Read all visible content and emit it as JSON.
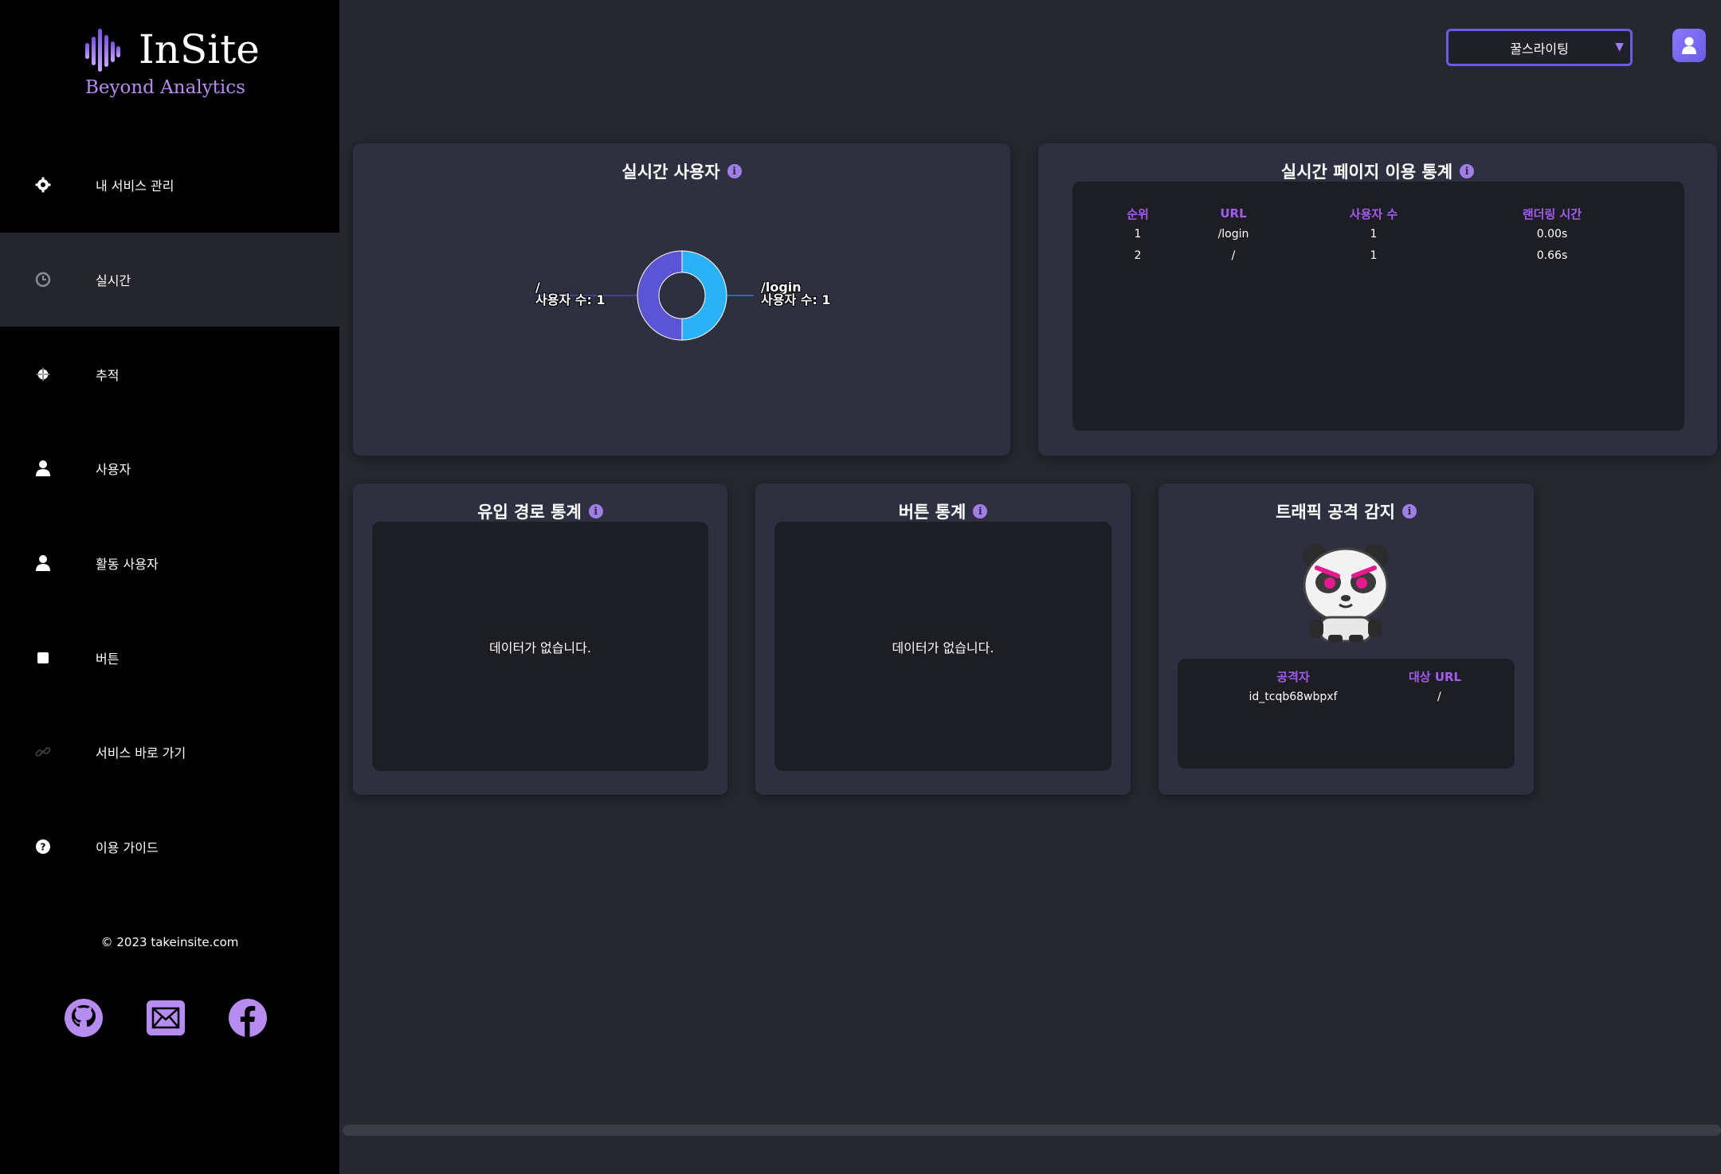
{
  "brand": {
    "title": "InSite",
    "subtitle": "Beyond Analytics",
    "accent": "#a06cf0"
  },
  "sidebar": {
    "items": [
      {
        "label": "내 서비스 관리",
        "icon": "gear-icon"
      },
      {
        "label": "실시간",
        "icon": "clock-icon",
        "active": true
      },
      {
        "label": "추적",
        "icon": "crosshair-icon"
      },
      {
        "label": "사용자",
        "icon": "user-icon"
      },
      {
        "label": "활동 사용자",
        "icon": "user-icon"
      },
      {
        "label": "버튼",
        "icon": "square-icon"
      },
      {
        "label": "서비스 바로 가기",
        "icon": "link-icon"
      },
      {
        "label": "이용 가이드",
        "icon": "help-circle-icon"
      }
    ],
    "copyright": "© 2023 takeinsite.com",
    "socials": [
      "github-icon",
      "mail-icon",
      "facebook-icon"
    ]
  },
  "header": {
    "service_select": "꿀스라이팅",
    "avatar_icon": "user-avatar-icon"
  },
  "realtime_users": {
    "title": "실시간 사용자",
    "chart_data": {
      "type": "pie",
      "donut": true,
      "slices": [
        {
          "name": "/",
          "value": 1,
          "color": "#5b55d6",
          "label_line1": "/",
          "label_line2": "사용자 수: 1"
        },
        {
          "name": "/login",
          "value": 1,
          "color": "#2bb1f7",
          "label_line1": "/login",
          "label_line2": "사용자 수: 1"
        }
      ]
    }
  },
  "page_stats": {
    "title": "실시간 페이지 이용 통계",
    "columns": [
      "순위",
      "URL",
      "사용자 수",
      "랜더링 시간"
    ],
    "rows": [
      [
        "1",
        "/login",
        "1",
        "0.00s"
      ],
      [
        "2",
        "/",
        "1",
        "0.66s"
      ]
    ]
  },
  "inflow": {
    "title": "유입 경로 통계",
    "empty": "데이터가 없습니다."
  },
  "buttons": {
    "title": "버튼 통계",
    "empty": "데이터가 없습니다."
  },
  "traffic": {
    "title": "트래픽 공격 감지",
    "columns": [
      "공격자",
      "대상 URL"
    ],
    "rows": [
      [
        "id_tcqb68wbpxf",
        "/"
      ]
    ]
  }
}
